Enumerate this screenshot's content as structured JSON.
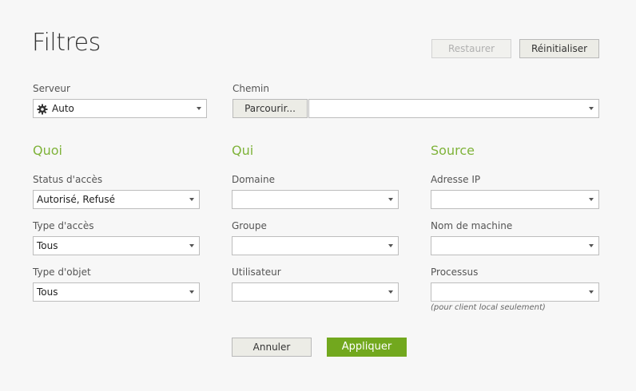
{
  "header": {
    "title": "Filtres",
    "restore_label": "Restaurer",
    "reset_label": "Réinitialiser"
  },
  "server": {
    "label": "Serveur",
    "value": "Auto",
    "icon": "gear-icon"
  },
  "path": {
    "label": "Chemin",
    "browse_label": "Parcourir...",
    "value": ""
  },
  "sections": {
    "what": {
      "title": "Quoi",
      "access_status": {
        "label": "Status d'accès",
        "value": "Autorisé, Refusé"
      },
      "access_type": {
        "label": "Type d'accès",
        "value": "Tous"
      },
      "object_type": {
        "label": "Type d'objet",
        "value": "Tous"
      }
    },
    "who": {
      "title": "Qui",
      "domain": {
        "label": "Domaine",
        "value": ""
      },
      "group": {
        "label": "Groupe",
        "value": ""
      },
      "user": {
        "label": "Utilisateur",
        "value": ""
      }
    },
    "source": {
      "title": "Source",
      "ip": {
        "label": "Adresse IP",
        "value": ""
      },
      "machine": {
        "label": "Nom de machine",
        "value": ""
      },
      "process": {
        "label": "Processus",
        "value": "",
        "note": "(pour client local seulement)"
      }
    }
  },
  "footer": {
    "cancel_label": "Annuler",
    "apply_label": "Appliquer"
  },
  "colors": {
    "accent": "#7fb33a",
    "primary_button": "#72a81e",
    "background": "#f7f7f7"
  }
}
